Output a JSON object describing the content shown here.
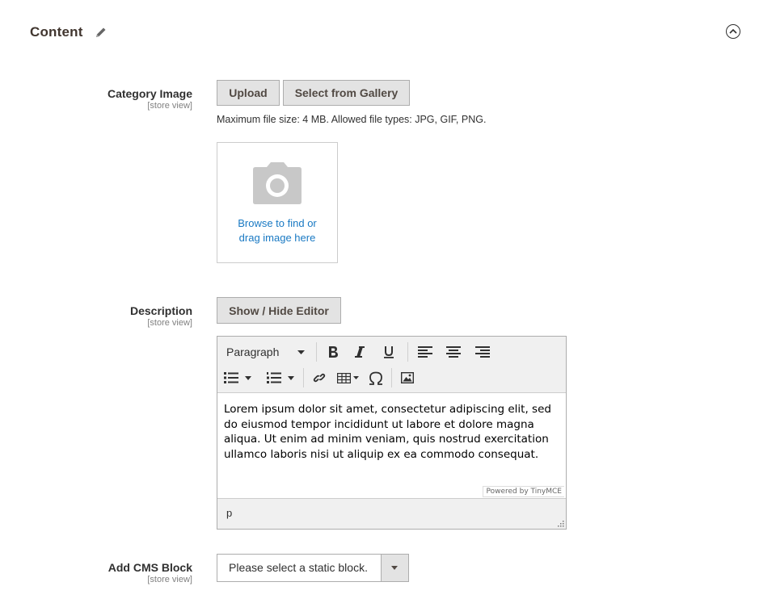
{
  "section": {
    "title": "Content"
  },
  "category_image": {
    "label": "Category Image",
    "scope": "[store view]",
    "upload_label": "Upload",
    "gallery_label": "Select from Gallery",
    "note": "Maximum file size: 4 MB. Allowed file types: JPG, GIF, PNG.",
    "browse_line1": "Browse to find or",
    "browse_line2": "drag image here"
  },
  "description": {
    "label": "Description",
    "scope": "[store view]",
    "toggle_label": "Show / Hide Editor",
    "format_value": "Paragraph",
    "content": "Lorem ipsum dolor sit amet, consectetur adipiscing elit, sed do eiusmod tempor incididunt ut labore et dolore magna aliqua. Ut enim ad minim veniam, quis nostrud exercitation ullamco laboris nisi ut aliquip ex ea commodo consequat.",
    "powered_by": "Powered by TinyMCE",
    "path": "p"
  },
  "cms_block": {
    "label": "Add CMS Block",
    "scope": "[store view]",
    "selected": "Please select a static block."
  },
  "colors": {
    "link": "#1979c3",
    "button_bg": "#e3e3e3",
    "border": "#adadad"
  },
  "icons": [
    "pencil-icon",
    "chevron-up-circle-icon",
    "camera-icon",
    "bold-icon",
    "italic-icon",
    "underline-icon",
    "align-left-icon",
    "align-center-icon",
    "align-right-icon",
    "bullet-list-icon",
    "numbered-list-icon",
    "link-icon",
    "table-icon",
    "special-char-icon",
    "image-icon",
    "resize-handle-icon",
    "dropdown-arrow-icon"
  ]
}
